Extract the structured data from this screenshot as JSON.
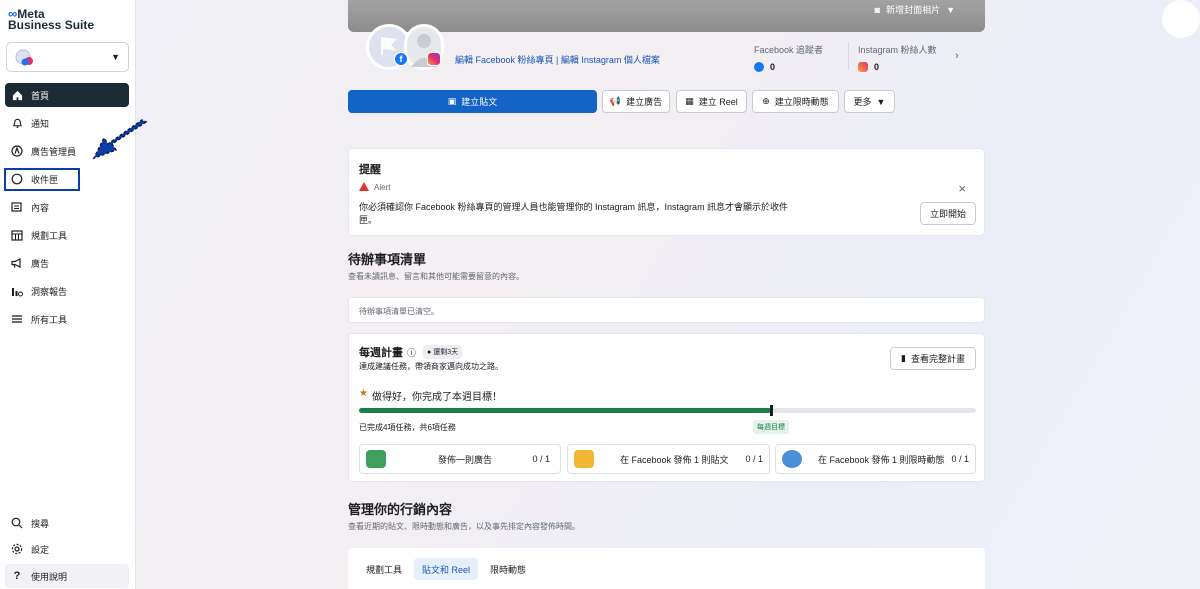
{
  "brand": {
    "line1": "Meta",
    "line2": "Business Suite"
  },
  "sidebar": {
    "items": [
      {
        "label": "首頁",
        "icon": "home-icon"
      },
      {
        "label": "通知",
        "icon": "bell-icon"
      },
      {
        "label": "廣告管理員",
        "icon": "ads-manager-icon"
      },
      {
        "label": "收件匣",
        "icon": "inbox-icon"
      },
      {
        "label": "內容",
        "icon": "content-icon"
      },
      {
        "label": "規劃工具",
        "icon": "calendar-icon"
      },
      {
        "label": "廣告",
        "icon": "megaphone-icon"
      },
      {
        "label": "洞察報告",
        "icon": "insights-icon"
      },
      {
        "label": "所有工具",
        "icon": "menu-icon"
      }
    ],
    "bottom": [
      {
        "label": "搜尋",
        "icon": "search-icon"
      },
      {
        "label": "設定",
        "icon": "gear-icon"
      },
      {
        "label": "使用說明",
        "icon": "help-icon"
      }
    ]
  },
  "cover": {
    "add_cover_label": "新增封面相片"
  },
  "profile": {
    "edit_fb": "編輯 Facebook 粉絲專頁",
    "sep": "|",
    "edit_ig": "編輯 Instagram 個人檔案"
  },
  "stats": {
    "fb_label": "Facebook 追蹤者",
    "fb_value": "0",
    "ig_label": "Instagram 粉絲人數",
    "ig_value": "0"
  },
  "actions": {
    "create_post": "建立貼文",
    "create_ad": "建立廣告",
    "create_reel": "建立 Reel",
    "create_story": "建立限時動態",
    "more": "更多"
  },
  "reminder": {
    "title": "提醒",
    "alert_label": "Alert",
    "message": "你必須確認你 Facebook 粉絲專頁的管理人員也能管理你的 Instagram 訊息，Instagram 訊息才會顯示於收件匣。",
    "start_button": "立即開始"
  },
  "todo": {
    "title": "待辦事項清單",
    "subtitle": "查看未讀訊息、留言和其他可能需要留意的內容。",
    "empty": "待辦事項清單已清空。"
  },
  "weekly": {
    "title": "每週計畫",
    "chip": "還剩3天",
    "subtitle": "達成建議任務，帶領商家邁向成功之路。",
    "view_full": "查看完整計畫",
    "done_message": "做得好，你完成了本週目標！",
    "progress_label": "已完成4項任務，共6項任務",
    "goal_label": "每週目標",
    "progress_fraction": 0.667,
    "tasks": [
      {
        "label": "發佈一則廣告",
        "count": "0 / 1"
      },
      {
        "label": "在 Facebook 發佈 1 則貼文",
        "count": "0 / 1"
      },
      {
        "label": "在 Facebook 發佈 1 則限時動態",
        "count": "0 / 1"
      }
    ]
  },
  "marketing": {
    "title": "管理你的行銷內容",
    "subtitle": "查看近期的貼文、限時動態和廣告，以及事先排定內容發佈時間。",
    "tabs": [
      "規劃工具",
      "貼文和 Reel",
      "限時動態"
    ]
  },
  "colors": {
    "primary": "#1463c6",
    "progress": "#1a7f4b",
    "alert": "#e0362c"
  }
}
